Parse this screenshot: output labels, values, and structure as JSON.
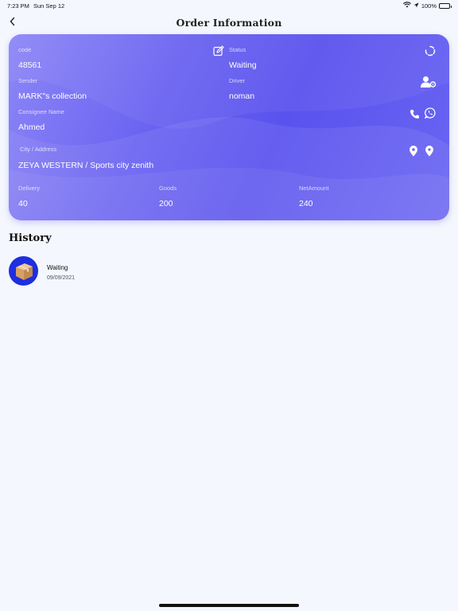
{
  "status_bar": {
    "time": "7:23 PM",
    "date": "Sun Sep 12",
    "battery": "100%",
    "icons": [
      "wifi-icon",
      "location-arrow-icon",
      "battery-icon"
    ]
  },
  "nav": {
    "title": "Order Information",
    "back_icon": "chevron-left-icon"
  },
  "order": {
    "code_label": "code",
    "code_value": "48561",
    "status_label": "Status",
    "status_value": "Waiting",
    "sender_label": "Sender",
    "sender_value": "MARK\"s collection",
    "driver_label": "Driver",
    "driver_value": "noman",
    "consignee_label": "Consignee Name",
    "consignee_value": "Ahmed",
    "address_label": "City / Address",
    "address_value": "ZEYA WESTERN / Sports city zenith",
    "delivery_label": "Delivery",
    "delivery_value": "40",
    "goods_label": "Goods",
    "goods_value": "200",
    "net_label": "NetAmount",
    "net_value": "240",
    "icons": [
      "edit-icon",
      "refresh-icon",
      "assign-driver-icon",
      "phone-icon",
      "whatsapp-icon",
      "location-pin-icon",
      "map-pin-icon"
    ]
  },
  "history": {
    "title": "History",
    "items": [
      {
        "status": "Waiting",
        "date": "09/09/2021",
        "icon": "package-box-icon"
      }
    ]
  },
  "colors": {
    "card_start": "#8d87f7",
    "card_mid": "#5a52ee",
    "avatar_bg": "#1d2fe0",
    "background": "#f4f7fd"
  }
}
